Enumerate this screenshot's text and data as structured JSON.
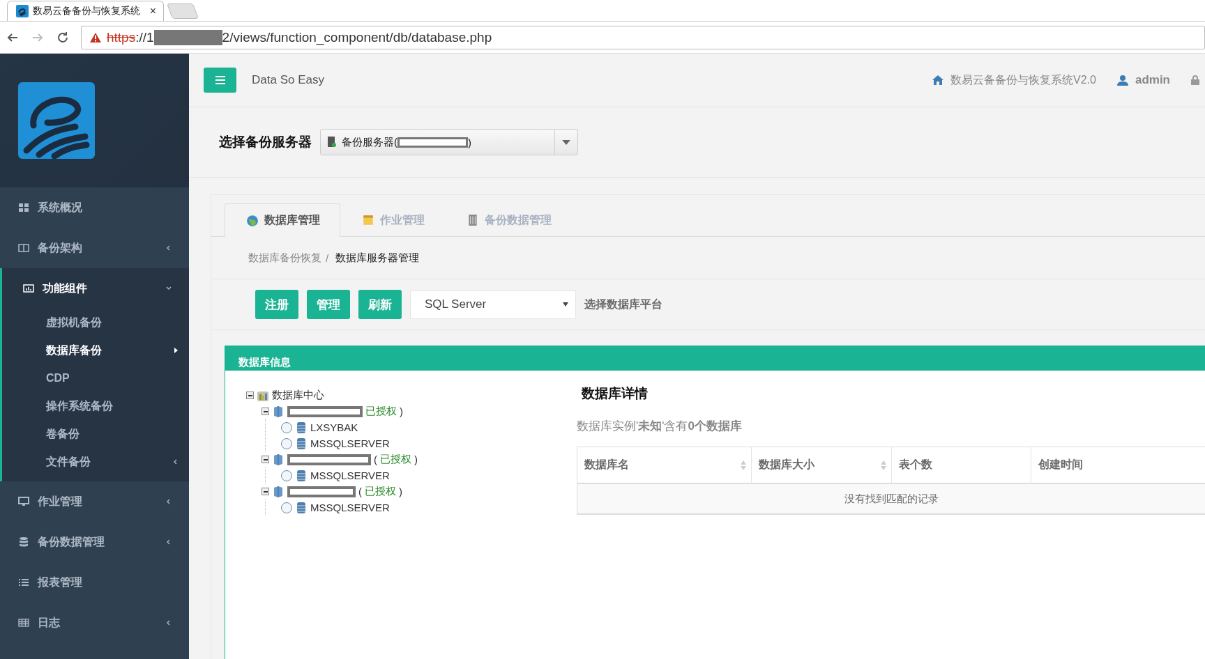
{
  "browser": {
    "tab_title": "数易云备备份与恢复系统",
    "tab_close": "×",
    "url_scheme": "https",
    "url_host_start": "://1",
    "url_rest": "2/views/function_component/db/database.php"
  },
  "sidebar": {
    "items": [
      {
        "label": "系统概况",
        "arrow": false,
        "expanded": false
      },
      {
        "label": "备份架构",
        "arrow": true,
        "expanded": false
      },
      {
        "label": "功能组件",
        "arrow": true,
        "expanded": true,
        "children": [
          {
            "label": "虚拟机备份",
            "selected": false,
            "arrow": false
          },
          {
            "label": "数据库备份",
            "selected": true,
            "arrow": false
          },
          {
            "label": "CDP",
            "selected": false,
            "arrow": false
          },
          {
            "label": "操作系统备份",
            "selected": false,
            "arrow": false
          },
          {
            "label": "卷备份",
            "selected": false,
            "arrow": false
          },
          {
            "label": "文件备份",
            "selected": false,
            "arrow": true
          }
        ]
      },
      {
        "label": "作业管理",
        "arrow": true,
        "expanded": false
      },
      {
        "label": "备份数据管理",
        "arrow": true,
        "expanded": false
      },
      {
        "label": "报表管理",
        "arrow": false,
        "expanded": false
      },
      {
        "label": "日志",
        "arrow": true,
        "expanded": false
      }
    ]
  },
  "header": {
    "brand": "Data So Easy",
    "system_name": "数易云备备份与恢复系统V2.0",
    "user": "admin"
  },
  "server_select": {
    "label": "选择备份服务器",
    "value_prefix": "备份服务器(",
    "value_suffix": ")"
  },
  "tabs": [
    {
      "label": "数据库管理",
      "selected": true
    },
    {
      "label": "作业管理",
      "selected": false
    },
    {
      "label": "备份数据管理",
      "selected": false
    }
  ],
  "breadcrumb": [
    {
      "label": "数据库备份恢复",
      "current": false,
      "separator": "/"
    },
    {
      "label": "数据库服务器管理",
      "current": true
    }
  ],
  "toolbar": {
    "buttons": [
      "注册",
      "管理",
      "刷新"
    ],
    "platform": "SQL Server",
    "platform_hint": "选择数据库平台"
  },
  "panel": {
    "title": "数据库信息",
    "tree": {
      "label": "数据库中心",
      "expanded": true,
      "servers": [
        {
          "status": "已授权",
          "close": ")",
          "expanded": true,
          "instances": [
            {
              "label": "LXSYBAK",
              "selected": false
            },
            {
              "label": "MSSQLSERVER",
              "selected": false
            }
          ]
        },
        {
          "open": "(",
          "status": "已授权",
          "close": ")",
          "expanded": true,
          "instances": [
            {
              "label": "MSSQLSERVER",
              "selected": false
            }
          ]
        },
        {
          "open": "(",
          "status": "已授权",
          "close": ")",
          "expanded": true,
          "instances": [
            {
              "label": "MSSQLSERVER",
              "selected": false
            }
          ]
        }
      ]
    },
    "details": {
      "title": "数据库详情",
      "summary": "数据库实例'**未知**'含有**0个数据库**",
      "columns": [
        {
          "label": "数据库名",
          "sortable": true
        },
        {
          "label": "数据库大小",
          "sortable": true
        },
        {
          "label": "表个数",
          "sortable": false
        },
        {
          "label": "创建时间",
          "sortable": false
        }
      ],
      "empty_message": "没有找到匹配的记录"
    }
  }
}
